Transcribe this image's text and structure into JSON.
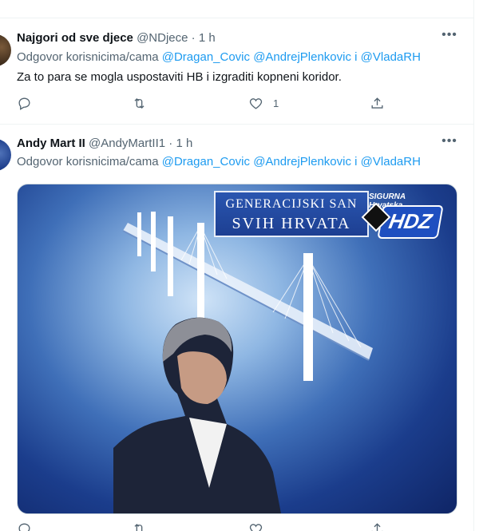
{
  "tweets": [
    {
      "name": "Najgori od sve djece",
      "handle": "@NDjece",
      "separator": "·",
      "time": "1 h",
      "more_icon": "more-horizontal-icon",
      "reply_prefix": "Odgovor korisnicima/cama",
      "mentions": [
        "@Dragan_Covic",
        "@AndrejPlenkovic"
      ],
      "mention_joiner": "i",
      "mention_last": "@VladaRH",
      "text": "Za to para se mogla uspostaviti HB i izgraditi kopneni koridor.",
      "actions": {
        "reply_count": "",
        "retweet_count": "",
        "like_count": "1"
      }
    },
    {
      "name": "Andy Mart II",
      "handle": "@AndyMartII1",
      "separator": "·",
      "time": "1 h",
      "more_icon": "more-horizontal-icon",
      "reply_prefix": "Odgovor korisnicima/cama",
      "mentions": [
        "@Dragan_Covic",
        "@AndrejPlenkovic"
      ],
      "mention_joiner": "i",
      "mention_last": "@VladaRH",
      "media": {
        "banner_line1": "GENERACIJSKI SAN",
        "banner_line2": "SVIH HRVATA",
        "logo_top": "SIGURNA Hrvatska",
        "logo_main": "HDZ"
      }
    }
  ],
  "colors": {
    "accent": "#1d9bf0",
    "secondary_text": "#536471",
    "primary_text": "#0f1419",
    "divider": "#eff3f4"
  }
}
